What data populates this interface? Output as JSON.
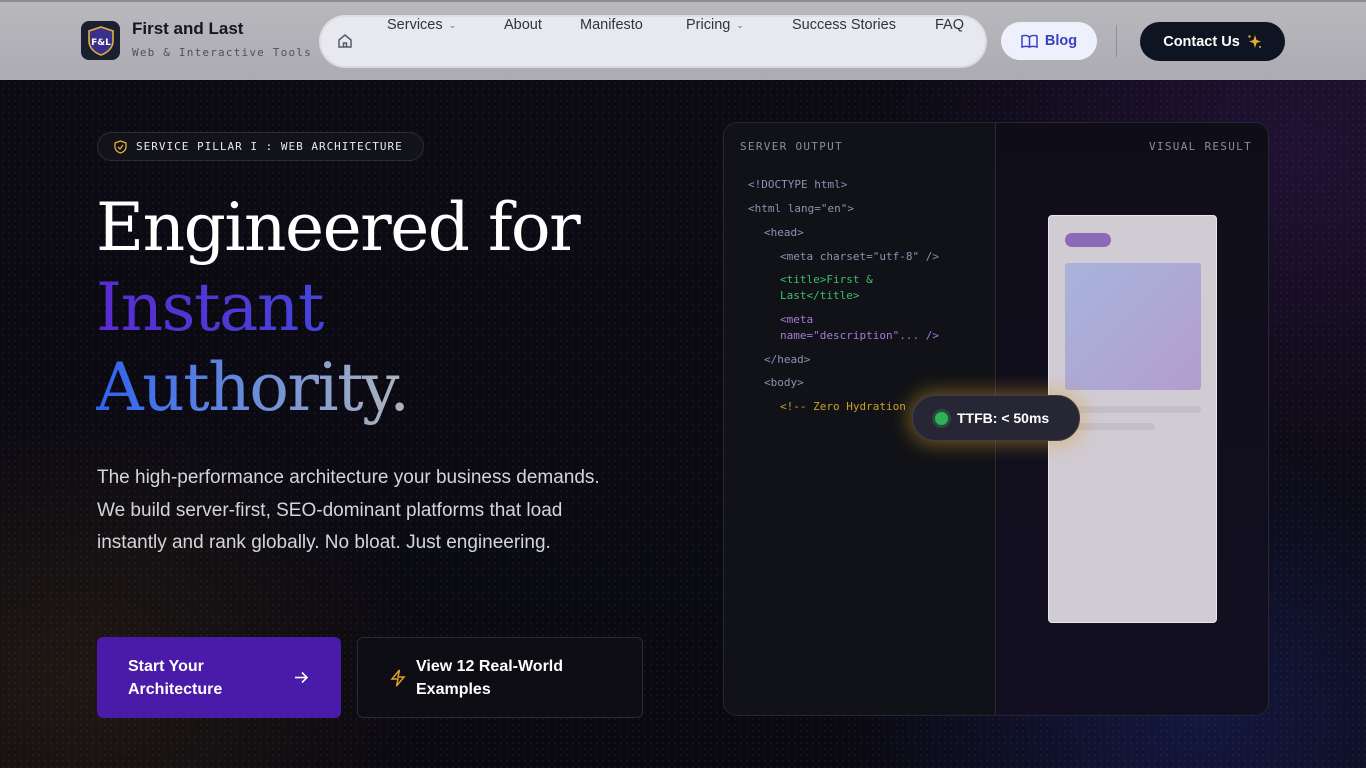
{
  "brand": {
    "name": "First and Last",
    "tagline": "Web & Interactive Tools",
    "logo_text": "F&L"
  },
  "nav": {
    "items": [
      {
        "label": "Services",
        "has_dropdown": true
      },
      {
        "label": "About",
        "has_dropdown": false
      },
      {
        "label": "Manifesto",
        "has_dropdown": false
      },
      {
        "label": "Pricing",
        "has_dropdown": true
      },
      {
        "label": "Success Stories",
        "has_dropdown": false
      },
      {
        "label": "FAQ",
        "has_dropdown": false
      }
    ],
    "blog_label": "Blog",
    "contact_label": "Contact Us"
  },
  "hero": {
    "badge": "SERVICE PILLAR I : WEB ARCHITECTURE",
    "title_line1": "Engineered for",
    "title_line2": "Instant",
    "title_line3": "Authority.",
    "description": "The high-performance architecture your business demands. We build server-first, SEO-dominant platforms that load instantly and rank globally. No bloat. Just engineering.",
    "cta_primary_line1": "Start Your",
    "cta_primary_line2": "Architecture",
    "cta_secondary_line1": "View 12 Real-World",
    "cta_secondary_line2": "Examples"
  },
  "panel": {
    "code_label": "SERVER OUTPUT",
    "visual_label": "VISUAL RESULT",
    "code_lines": {
      "l1": "<!DOCTYPE html>",
      "l2": "<html lang=\"en\">",
      "l3": "<head>",
      "l4": "<meta charset=\"utf-8\" />",
      "l5a": "<title>First &",
      "l5b": "Last</title>",
      "l6a": "<meta",
      "l6b": "name=\"description\"... />",
      "l7": "</head>",
      "l8": "<body>",
      "l9": "<!-- Zero Hydration"
    },
    "ttfb": "TTFB: < 50ms"
  },
  "colors": {
    "accent_purple": "#4a1aa8",
    "blog_blue": "#3b3fc4",
    "status_green": "#2fb357",
    "glow_gold": "#dca028"
  },
  "icons": {
    "home": "home-icon",
    "blog": "book-icon",
    "contact": "sparkle-icon",
    "badge": "shield-check-icon",
    "cta_primary": "arrow-right-icon",
    "cta_secondary": "lightning-icon"
  }
}
